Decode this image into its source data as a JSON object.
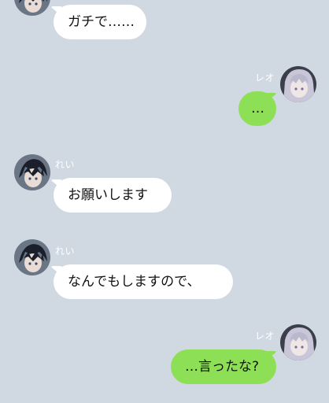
{
  "colors": {
    "background": "#d0d8e2",
    "incoming_bubble": "#ffffff",
    "outgoing_bubble": "#8de055",
    "name_text": "#ffffff"
  },
  "messages": [
    {
      "sender": "",
      "side": "incoming",
      "text": "ガチで……",
      "avatar": "rei-avatar"
    },
    {
      "sender": "レオ",
      "side": "outgoing",
      "text": "…",
      "avatar": "reo-avatar"
    },
    {
      "sender": "れい",
      "side": "incoming",
      "text": "お願いします",
      "avatar": "rei-avatar"
    },
    {
      "sender": "れい",
      "side": "incoming",
      "text": "なんでもしますので、",
      "avatar": "rei-avatar"
    },
    {
      "sender": "レオ",
      "side": "outgoing",
      "text": "…言ったな?",
      "avatar": "reo-avatar"
    }
  ]
}
